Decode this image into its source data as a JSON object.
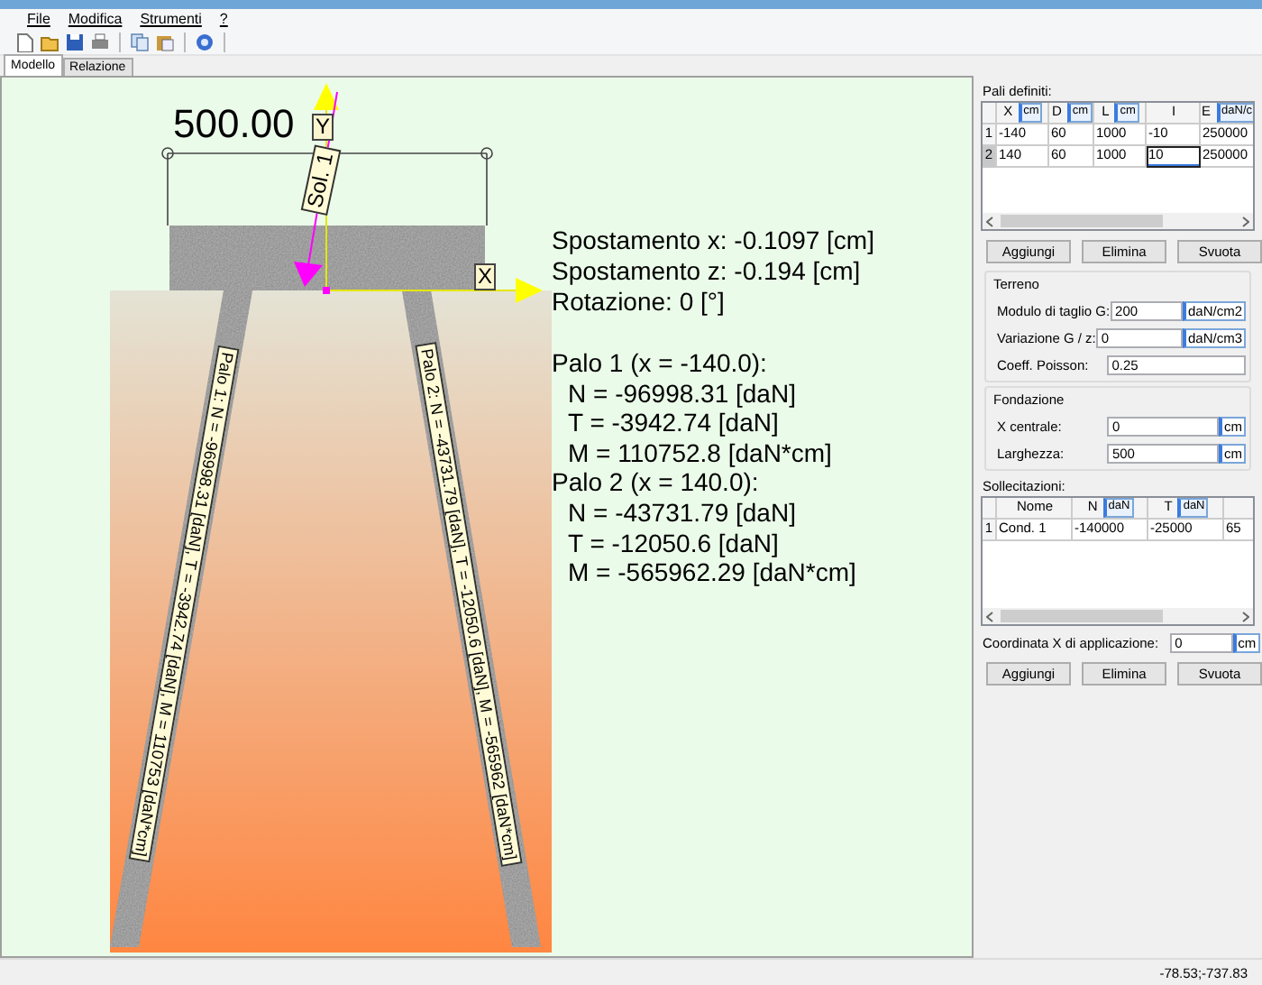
{
  "menu": [
    {
      "label": "File"
    },
    {
      "label": "Modifica"
    },
    {
      "label": "Strumenti"
    },
    {
      "label": "?"
    }
  ],
  "tabs": [
    {
      "label": "Modello",
      "selected": true
    },
    {
      "label": "Relazione",
      "selected": false
    }
  ],
  "canvas": {
    "dimension": "500.00",
    "axis_y_label": "Y",
    "axis_x_label": "X",
    "load_label": "Sol. 1",
    "piles": [
      {
        "label": "Palo 1: N = -96998.31 [daN], T = -3942.74 [daN], M = 110753 [daN*cm]"
      },
      {
        "label": "Palo 2: N = -43731.79 [daN], T = -12050.6 [daN], M = -565962 [daN*cm]"
      }
    ],
    "displacements": [
      "Spostamento x: -0.1097 [cm]",
      "Spostamento z: -0.194 [cm]",
      "Rotazione: 0 [°]"
    ],
    "pile_results": [
      {
        "title": "Palo 1 (x = -140.0):",
        "values": [
          "N = -96998.31 [daN]",
          "T = -3942.74 [daN]",
          "M = 110752.8 [daN*cm]"
        ]
      },
      {
        "title": "Palo 2 (x = 140.0):",
        "values": [
          "N = -43731.79 [daN]",
          "T = -12050.6 [daN]",
          "M = -565962.29 [daN*cm]"
        ]
      }
    ]
  },
  "side_panel": {
    "piles_table": {
      "title": "Pali definiti:",
      "columns": [
        {
          "label": "X",
          "unit": "cm"
        },
        {
          "label": "D",
          "unit": "cm"
        },
        {
          "label": "L",
          "unit": "cm"
        },
        {
          "label": "I"
        },
        {
          "label": "E",
          "unit": "daN/c"
        }
      ],
      "rows": [
        {
          "number": "1",
          "selected": false,
          "cells": [
            {
              "text": "-140",
              "editing": false
            },
            {
              "text": "60",
              "editing": false
            },
            {
              "text": "1000",
              "editing": false
            },
            {
              "text": "-10",
              "editing": false
            },
            {
              "text": "250000",
              "editing": false
            }
          ]
        },
        {
          "number": "2",
          "selected": true,
          "cells": [
            {
              "text": "140",
              "editing": false
            },
            {
              "text": "60",
              "editing": false
            },
            {
              "text": "1000",
              "editing": false
            },
            {
              "text": "10",
              "editing": true
            },
            {
              "text": "250000",
              "editing": false
            }
          ]
        }
      ]
    },
    "piles_buttons": [
      "Aggiungi",
      "Elimina",
      "Svuota"
    ],
    "groups": [
      {
        "title": "Terreno",
        "fields": [
          {
            "label": "Modulo di taglio G:",
            "value": "200",
            "unit": "daN/cm2"
          },
          {
            "label": "Variazione G / z:",
            "value": "0",
            "unit": "daN/cm3"
          },
          {
            "label": "Coeff. Poisson:",
            "value": "0.25"
          }
        ]
      },
      {
        "title": "Fondazione",
        "fields": [
          {
            "label": "X centrale:",
            "value": "0",
            "unit": "cm"
          },
          {
            "label": "Larghezza:",
            "value": "500",
            "unit": "cm"
          }
        ]
      }
    ],
    "loads_table": {
      "title": "Sollecitazioni:",
      "columns": [
        {
          "label": "Nome"
        },
        {
          "label": "N",
          "unit": "daN"
        },
        {
          "label": "T",
          "unit": "daN"
        }
      ],
      "rows": [
        {
          "number": "1",
          "selected": false,
          "cells": [
            {
              "text": "Cond. 1",
              "editing": false
            },
            {
              "text": "-140000",
              "editing": false
            },
            {
              "text": "-25000",
              "editing": false
            },
            {
              "text": "65",
              "editing": false
            }
          ]
        }
      ]
    },
    "application_field": {
      "label": "Coordinata X di applicazione:",
      "value": "0",
      "unit": "cm"
    },
    "loads_buttons": [
      "Aggiungi",
      "Elimina",
      "Svuota"
    ]
  },
  "status_bar": {
    "coordinates": "-78.53;-737.83"
  }
}
